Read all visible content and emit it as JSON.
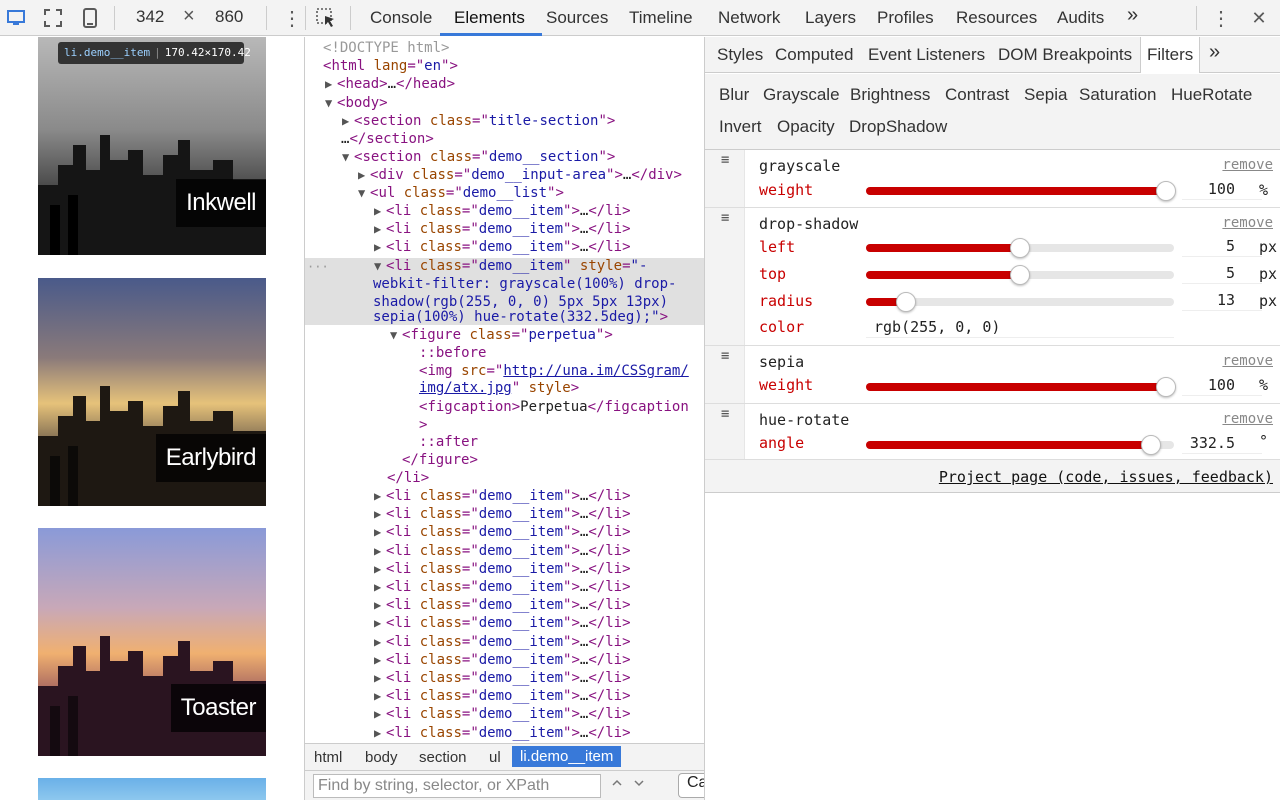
{
  "toolbar": {
    "width": "342",
    "times": "×",
    "height": "860",
    "tabs": [
      "Console",
      "Elements",
      "Sources",
      "Timeline",
      "Network",
      "Layers",
      "Profiles",
      "Resources",
      "Audits"
    ],
    "more": "»",
    "close": "✕",
    "menu": "⋮"
  },
  "preview": {
    "tooltip_selector": "li.demo__item",
    "tooltip_size": "170.42×170.42",
    "captions": [
      "Inkwell",
      "Earlybird",
      "Toaster"
    ]
  },
  "dom": {
    "doctype": "<!DOCTYPE html>",
    "lines": {
      "html_open": "html",
      "lang_attr": "lang",
      "lang_val": "en",
      "head": "head",
      "body": "body",
      "section": "section",
      "class_attr": "class",
      "title_section": "title-section",
      "demo_section": "demo__section",
      "div": "div",
      "input_area": "demo__input-area",
      "ul": "ul",
      "demo_list": "demo__list",
      "li": "li",
      "demo_item": "demo__item",
      "style_attr": "style",
      "style_val_1": "\"-",
      "style_val_2": "webkit-filter: grayscale(100%) drop-",
      "style_val_3": "shadow(rgb(255, 0, 0) 5px 5px 13px)",
      "style_val_4": "sepia(100%) hue-rotate(332.5deg);",
      "figure": "figure",
      "perpetua": "perpetua",
      "before": "::before",
      "img": "img",
      "src_attr": "src",
      "src_val_1": "http://una.im/CSSgram/",
      "src_val_2": "img/atx.jpg",
      "figcaption": "figcaption",
      "figcaption_text": "Perpetua",
      "after": "::after",
      "ellipsis": "…",
      "dots": "···"
    }
  },
  "breadcrumbs": [
    "html",
    "body",
    "section",
    "ul",
    "li.demo__item"
  ],
  "search": {
    "placeholder": "Find by string, selector, or XPath",
    "cancel": "Cancel"
  },
  "sidebar": {
    "tabs": [
      "Styles",
      "Computed",
      "Event Listeners",
      "DOM Breakpoints",
      "Filters"
    ],
    "more": "»",
    "filter_types": [
      "Blur",
      "Grayscale",
      "Brightness",
      "Contrast",
      "Sepia",
      "Saturation",
      "HueRotate",
      "Invert",
      "Opacity",
      "DropShadow"
    ],
    "remove_label": "remove",
    "filters": [
      {
        "name": "grayscale",
        "params": [
          {
            "label": "weight",
            "value": "100",
            "unit": "%",
            "level": 1.0
          }
        ]
      },
      {
        "name": "drop-shadow",
        "params": [
          {
            "label": "left",
            "value": "5",
            "unit": "px",
            "level": 0.5
          },
          {
            "label": "top",
            "value": "5",
            "unit": "px",
            "level": 0.5
          },
          {
            "label": "radius",
            "value": "13",
            "unit": "px",
            "level": 0.13
          },
          {
            "label": "color",
            "value": "rgb(255, 0, 0)"
          }
        ]
      },
      {
        "name": "sepia",
        "params": [
          {
            "label": "weight",
            "value": "100",
            "unit": "%",
            "level": 1.0
          }
        ]
      },
      {
        "name": "hue-rotate",
        "params": [
          {
            "label": "angle",
            "value": "332.5",
            "unit": "°",
            "level": 0.924
          }
        ]
      }
    ],
    "project_link": "Project page (code, issues, feedback)"
  },
  "colors": {
    "accent": "#3879d9",
    "slider": "#c80000"
  }
}
